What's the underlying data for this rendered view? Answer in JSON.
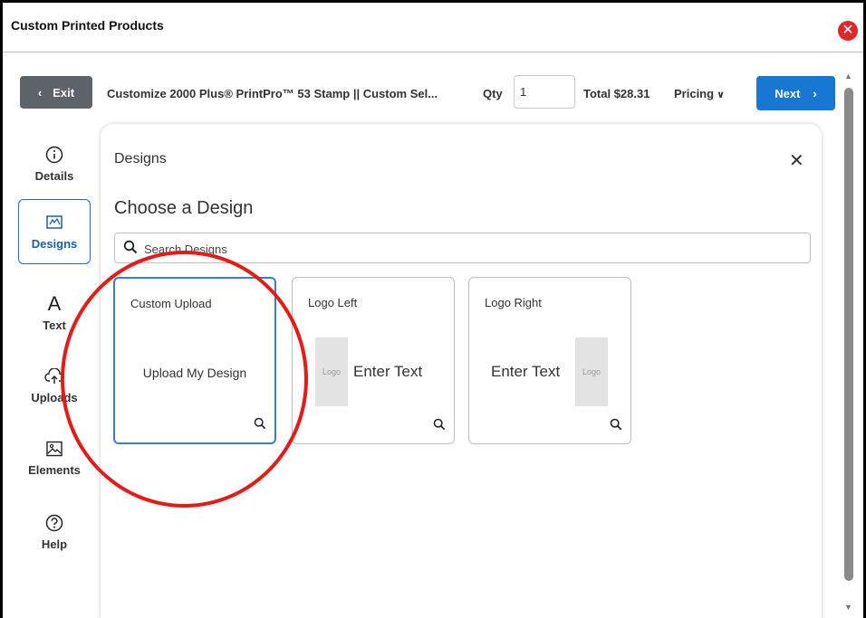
{
  "window": {
    "title": "Custom Printed Products",
    "close_icon": "close-circle-icon",
    "close_color": "#e0262a"
  },
  "toolbar": {
    "exit_label": "Exit",
    "product_title": "Customize 2000 Plus® PrintPro™ 53 Stamp || Custom Sel...",
    "qty_label": "Qty",
    "qty_value": "1",
    "total": "Total $28.31",
    "pricing_label": "Pricing",
    "next_label": "Next",
    "accent": "#1877d2"
  },
  "sidebar": {
    "items": [
      {
        "label": "Details",
        "icon": "info-icon"
      },
      {
        "label": "Designs",
        "icon": "designs-icon",
        "active": true
      },
      {
        "label": "Text",
        "icon": "text-icon"
      },
      {
        "label": "Uploads",
        "icon": "upload-icon"
      },
      {
        "label": "Elements",
        "icon": "image-icon"
      },
      {
        "label": "Help",
        "icon": "help-icon"
      }
    ]
  },
  "panel": {
    "title": "Designs",
    "heading": "Choose a Design",
    "search_placeholder": "Search Designs",
    "cards": [
      {
        "title": "Custom Upload",
        "preview_text": "Upload My Design",
        "selected": true
      },
      {
        "title": "Logo Left",
        "logo_text": "Logo",
        "enter_text": "Enter Text"
      },
      {
        "title": "Logo Right",
        "logo_text": "Logo",
        "enter_text": "Enter Text"
      }
    ]
  },
  "annotation": {
    "shape": "circle",
    "color": "#e41b17",
    "target": "Custom Upload"
  }
}
